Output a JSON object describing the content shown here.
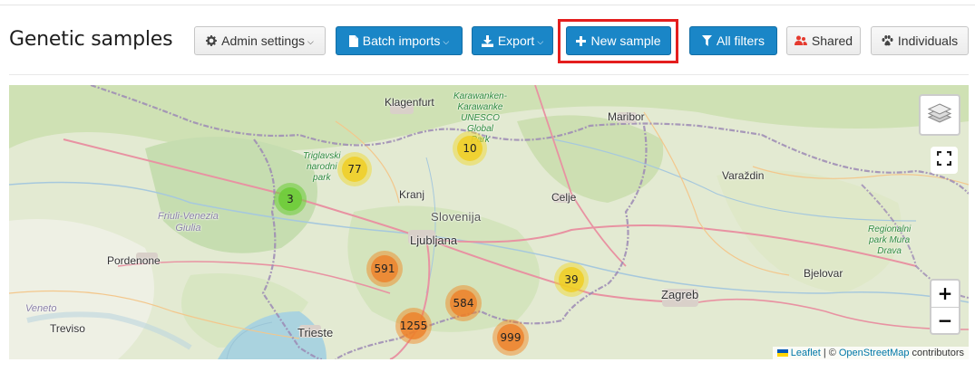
{
  "page": {
    "title": "Genetic samples"
  },
  "toolbar": {
    "admin_settings": "Admin settings",
    "batch_imports": "Batch imports",
    "export": "Export",
    "new_sample": "New sample",
    "all_filters": "All filters",
    "shared": "Shared",
    "individuals": "Individuals"
  },
  "icons": {
    "admin_settings": "gear-icon",
    "batch_imports": "file-icon",
    "export": "download-icon",
    "new_sample": "plus-icon",
    "all_filters": "filter-icon",
    "shared": "users-icon",
    "individuals": "paw-icon"
  },
  "colors": {
    "primary": "#1a86c7",
    "highlight": "#e41e1e",
    "cluster_small": "#6ecc39",
    "cluster_medium": "#f0c20c",
    "cluster_large": "#f18017"
  },
  "map": {
    "clusters": [
      {
        "count": "3",
        "size": "small"
      },
      {
        "count": "77",
        "size": "medium"
      },
      {
        "count": "10",
        "size": "medium"
      },
      {
        "count": "39",
        "size": "medium"
      },
      {
        "count": "591",
        "size": "large"
      },
      {
        "count": "584",
        "size": "large"
      },
      {
        "count": "1255",
        "size": "large"
      },
      {
        "count": "999",
        "size": "large"
      }
    ],
    "labels": {
      "klagenfurt": "Klagenfurt",
      "karawanken": "Karawanken-\nKarawanke\nUNESCO\nGlobal\nPark",
      "maribor": "Maribor",
      "triglav": "Triglavski\nnarodni\npark",
      "varazdin": "Varaždin",
      "kranj": "Kranj",
      "celje": "Celje",
      "slovenija": "Slovenija",
      "ljubljana": "Ljubljana",
      "friuli": "Friuli-Venezia\nGiulia",
      "regionalni": "Regionalni\npark Mura\nDrava",
      "pordenone": "Pordenone",
      "bjelovar": "Bjelovar",
      "zagreb": "Zagreb",
      "veneto": "Veneto",
      "treviso": "Treviso",
      "trieste": "Trieste"
    },
    "controls": {
      "zoom_in": "+",
      "zoom_out": "−"
    },
    "attribution": {
      "leaflet": "Leaflet",
      "separator": " | © ",
      "osm": "OpenStreetMap",
      "contributors": " contributors"
    }
  }
}
